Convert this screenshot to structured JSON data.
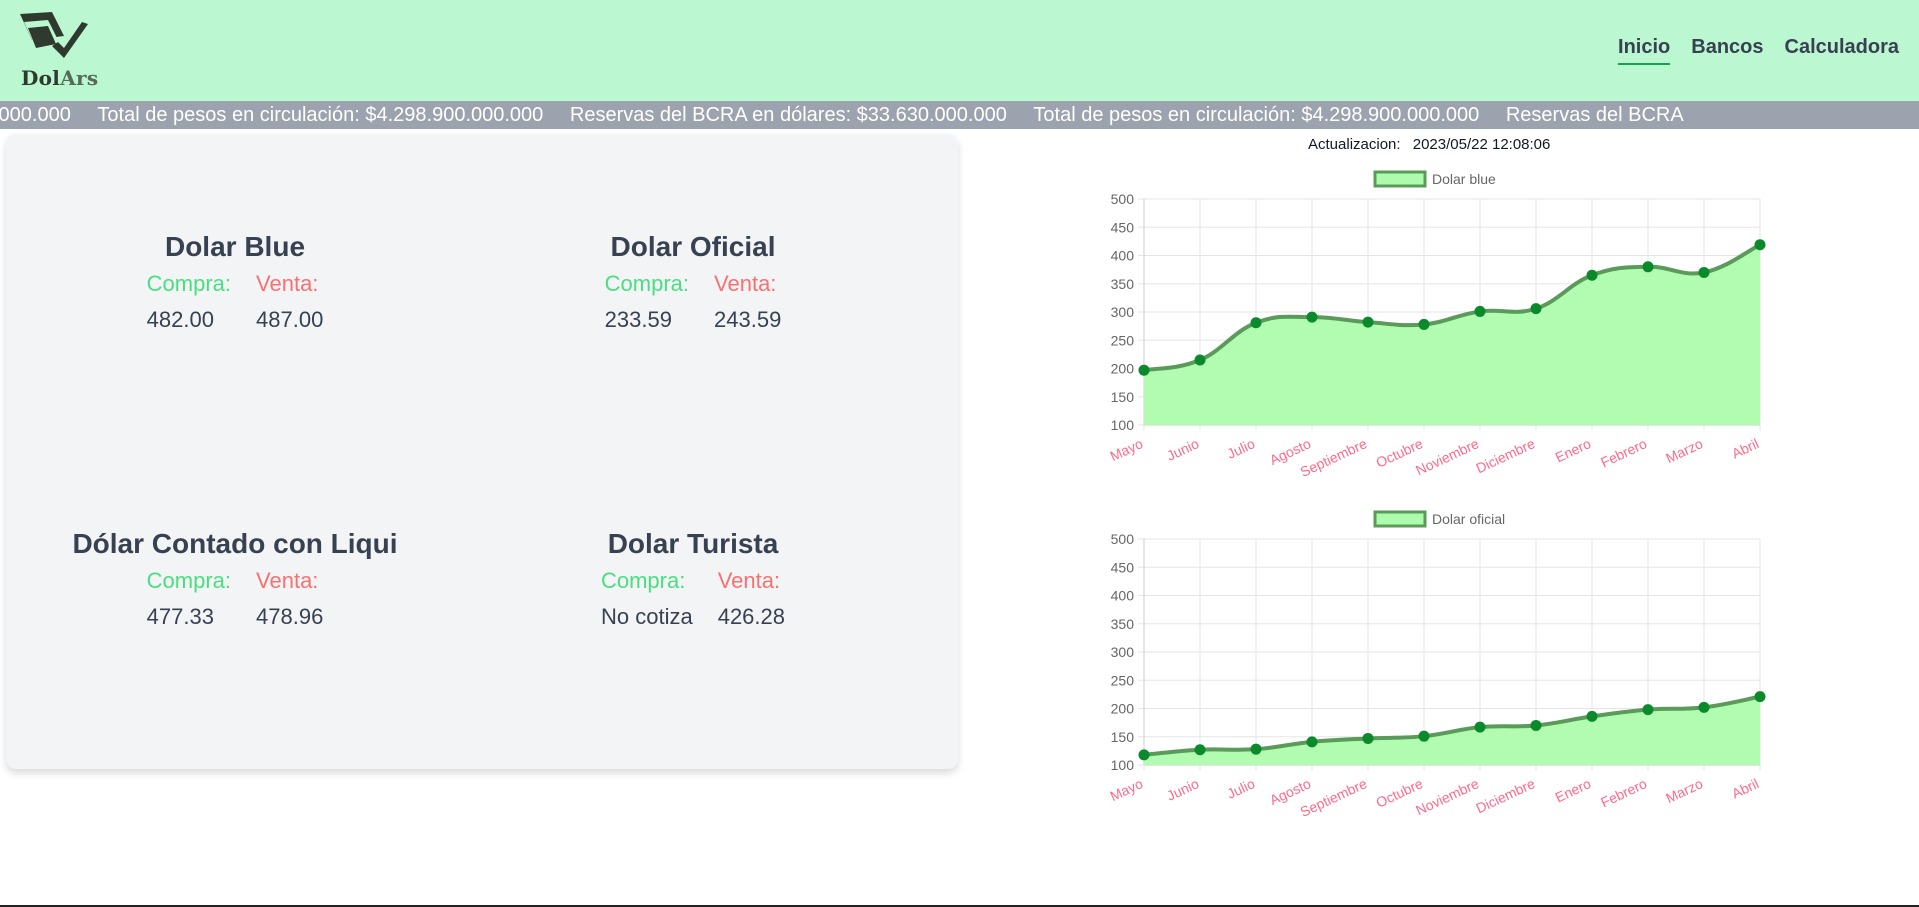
{
  "brand": {
    "name_prefix": "Dol",
    "name_suffix": "Ars",
    "logo_icon": "dollar-check-logo-icon"
  },
  "nav": [
    {
      "label": "Inicio",
      "active": true
    },
    {
      "label": "Bancos",
      "active": false
    },
    {
      "label": "Calculadora",
      "active": false
    }
  ],
  "ticker": [
    "dólares: $33.630.000.000",
    "Total de pesos en circulación: $4.298.900.000.000",
    "Reservas del BCRA en dólares: $33.630.000.000",
    "Total de pesos en circulación: $4.298.900.000.000",
    "Reservas del BCRA"
  ],
  "rates": [
    {
      "title": "Dolar Blue",
      "buy_label": "Compra:",
      "sell_label": "Venta:",
      "buy": "482.00",
      "sell": "487.00"
    },
    {
      "title": "Dolar Oficial",
      "buy_label": "Compra:",
      "sell_label": "Venta:",
      "buy": "233.59",
      "sell": "243.59"
    },
    {
      "title": "Dólar Contado con Liqui",
      "buy_label": "Compra:",
      "sell_label": "Venta:",
      "buy": "477.33",
      "sell": "478.96"
    },
    {
      "title": "Dolar Turista",
      "buy_label": "Compra:",
      "sell_label": "Venta:",
      "buy": "No cotiza",
      "sell": "426.28"
    }
  ],
  "update": {
    "label": "Actualizacion:",
    "value": "2023/05/22 12:08:06"
  },
  "colors": {
    "header_bg": "#bbf7d0",
    "ticker_bg": "#9ca3af",
    "card_bg": "#f3f4f6",
    "buy": "#4ade80",
    "sell": "#f87171",
    "line": "#5a9a5a",
    "fill": "#adfcad",
    "point": "#0a8a2a",
    "tick_x": "#ff6a8a"
  },
  "chart_data": [
    {
      "type": "line",
      "categories": [
        "Mayo",
        "Junio",
        "Julio",
        "Agosto",
        "Septiembre",
        "Octubre",
        "Noviembre",
        "Diciembre",
        "Enero",
        "Febrero",
        "Marzo",
        "Abril"
      ],
      "series": [
        {
          "name": "Dolar blue",
          "values": [
            197,
            215,
            281,
            291,
            282,
            278,
            301,
            306,
            365,
            380,
            370,
            419
          ]
        }
      ],
      "yticks": [
        100,
        150,
        200,
        250,
        300,
        350,
        400,
        450,
        500
      ],
      "ylim": [
        100,
        500
      ],
      "grid": true,
      "fill": true,
      "legend": "top"
    },
    {
      "type": "line",
      "categories": [
        "Mayo",
        "Junio",
        "Julio",
        "Agosto",
        "Septiembre",
        "Octubre",
        "Noviembre",
        "Diciembre",
        "Enero",
        "Febrero",
        "Marzo",
        "Abril"
      ],
      "series": [
        {
          "name": "Dolar oficial",
          "values": [
            118,
            127,
            128,
            141,
            147,
            151,
            167,
            170,
            186,
            198,
            202,
            221
          ]
        }
      ],
      "yticks": [
        100,
        150,
        200,
        250,
        300,
        350,
        400,
        450,
        500
      ],
      "ylim": [
        100,
        500
      ],
      "grid": true,
      "fill": true,
      "legend": "top"
    }
  ]
}
